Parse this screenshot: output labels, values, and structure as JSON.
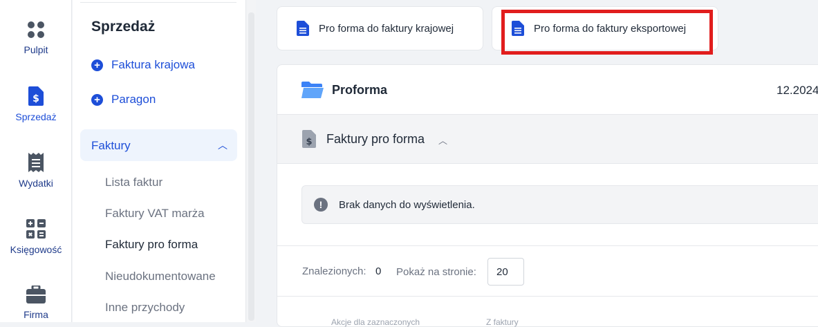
{
  "rail": {
    "items": [
      {
        "label": "Pulpit",
        "icon": "grid-dots-icon"
      },
      {
        "label": "Sprzedaż",
        "icon": "dollar-document-icon"
      },
      {
        "label": "Wydatki",
        "icon": "receipt-icon"
      },
      {
        "label": "Księgowość",
        "icon": "calculator-icon"
      },
      {
        "label": "Firma",
        "icon": "briefcase-icon"
      }
    ],
    "active": "Sprzedaż"
  },
  "sidebar": {
    "title": "Sprzedaż",
    "actions": [
      {
        "label": "Faktura krajowa",
        "icon": "plus-circle-icon"
      },
      {
        "label": "Paragon",
        "icon": "plus-circle-icon"
      }
    ],
    "group": {
      "label": "Faktury",
      "icon": "chevron-up-icon"
    },
    "subitems": [
      {
        "label": "Lista faktur"
      },
      {
        "label": "Faktury VAT marża"
      },
      {
        "label": "Faktury pro forma"
      },
      {
        "label": "Nieudokumentowane"
      },
      {
        "label": "Inne przychody"
      }
    ],
    "current": "Faktury pro forma"
  },
  "tabs": [
    {
      "label": "Pro forma do faktury krajowej",
      "icon": "document-icon"
    },
    {
      "label": "Pro forma do faktury eksportowej",
      "icon": "document-icon"
    }
  ],
  "card": {
    "title": "Proforma",
    "date": "12.2024",
    "section_label": "Faktury pro forma",
    "empty_message": "Brak danych do wyświetlenia.",
    "found_label": "Znalezionych:",
    "found_value": "0",
    "per_page_label": "Pokaż na stronie:",
    "per_page_value": "20",
    "table_headers": [
      "Akcje dla zaznaczonych",
      "Z faktury"
    ]
  },
  "colors": {
    "accent": "#1d4ed8",
    "highlight": "#e11d1d",
    "background": "#f1f3f6"
  }
}
